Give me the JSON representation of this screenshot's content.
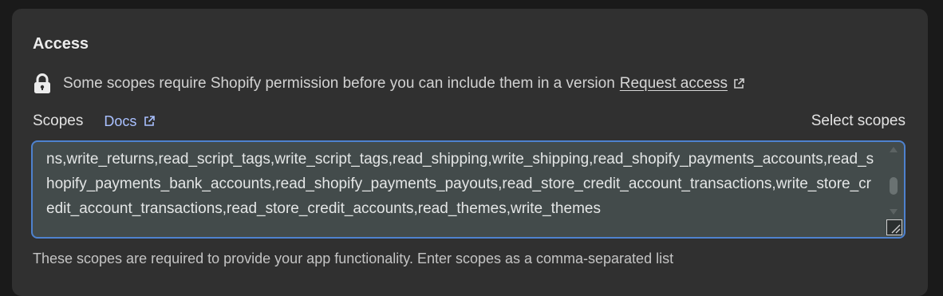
{
  "section": {
    "title": "Access"
  },
  "notice": {
    "text": "Some scopes require Shopify permission before you can include them in a version",
    "link_label": "Request access"
  },
  "scopes": {
    "label": "Scopes",
    "docs_label": "Docs",
    "select_label": "Select scopes",
    "value": "ns,write_returns,read_script_tags,write_script_tags,read_shipping,write_shipping,read_shopify_payments_accounts,read_shopify_payments_bank_accounts,read_shopify_payments_payouts,read_store_credit_account_transactions,write_store_credit_account_transactions,read_store_credit_accounts,read_themes,write_themes",
    "helper_text": "These scopes are required to provide your app functionality. Enter scopes as a comma-separated list"
  },
  "icons": {
    "lock": "lock-icon",
    "external_link": "external-link-icon"
  },
  "colors": {
    "card_bg": "#303030",
    "page_bg": "#1a1a1a",
    "focus_border": "#4e82cf",
    "link": "#a9c0ff"
  }
}
